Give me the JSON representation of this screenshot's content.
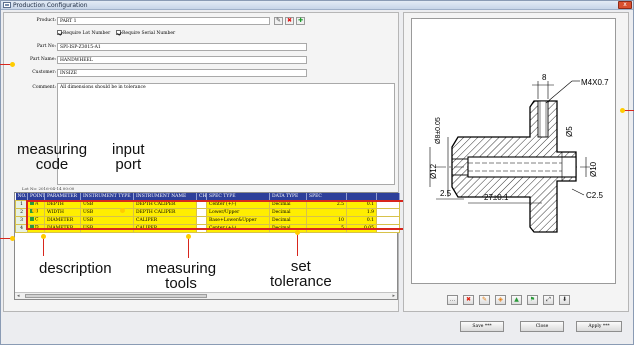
{
  "window": {
    "title": "Production Configuration",
    "close_label": "x"
  },
  "form": {
    "product_label": "Product:",
    "product_value": "PART 1",
    "require_lot_label": "Require Lot Number",
    "require_serial_label": "Require Serial Number",
    "part_no_label": "Part No:",
    "part_no_value": "SPI-ISP-Z3015-A1",
    "part_name_label": "Part Name:",
    "part_name_value": "HANDWHEEL",
    "customer_label": "Customer:",
    "customer_value": "INSIZE",
    "comment_label": "Comment:",
    "comment_value": "All dimensions should be in tolerance",
    "lot_strip": "Lot No: 2016-04-14 00:00"
  },
  "table": {
    "headers": [
      "NO.",
      "POINT",
      "PARAMETER",
      "INSTRUMENT TYPE",
      "INSTRUMENT NAME",
      "CH",
      "SPEC TYPE",
      "DATA TYPE",
      "SPEC",
      "",
      ""
    ],
    "rows": [
      {
        "no": "1",
        "point": "A",
        "parameter": "DEPTH",
        "type": "USB",
        "name": "DEPTH CALIPER",
        "ch": "",
        "spec_type": "Center (+/-)",
        "data_type": "Decimal",
        "spec": "2.5",
        "tol": "0.1"
      },
      {
        "no": "2",
        "point": "B",
        "parameter": "WIDTH",
        "type": "USB",
        "name": "DEPTH CALIPER",
        "ch": "",
        "spec_type": "Lower/Upper",
        "data_type": "Decimal",
        "spec": "",
        "tol": "1.9"
      },
      {
        "no": "3",
        "point": "C",
        "parameter": "DIAMETER",
        "type": "USB",
        "name": "CALIPER",
        "ch": "",
        "spec_type": "Base+Lower&Upper",
        "data_type": "Decimal",
        "spec": "10",
        "tol": "0.1"
      },
      {
        "no": "4",
        "point": "D",
        "parameter": "DIAMETER",
        "type": "USB",
        "name": "CALIPER",
        "ch": "",
        "spec_type": "Center (+/-)",
        "data_type": "Decimal",
        "spec": "5",
        "tol": "0.05"
      }
    ]
  },
  "annotations": {
    "measuring_code": "measuring\ncode",
    "input_port": "input\nport",
    "description": "description",
    "measuring_tools": "measuring\ntools",
    "set_tolerance": "set\ntolerance"
  },
  "drawing": {
    "dims": [
      "8",
      "M4X0.7",
      "Ø8±0.05",
      "Ø5",
      "Ø12",
      "Ø10",
      "2.5",
      "27±0.1",
      "C2.5"
    ]
  },
  "buttons": {
    "save": "Save ***",
    "close": "Close",
    "apply": "Apply ***"
  },
  "colors": {
    "accent": "#2d3f9a",
    "highlight": "#ffee00",
    "annotation": "#d8261d"
  }
}
